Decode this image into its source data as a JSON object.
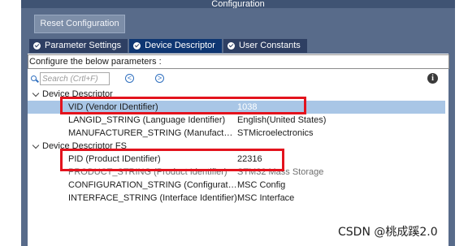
{
  "window": {
    "title": "Configuration"
  },
  "reset_button": {
    "label": "Reset Configuration"
  },
  "tabs": [
    {
      "label": "Parameter Settings",
      "icon": "check-circle-icon"
    },
    {
      "label": "Device Descriptor",
      "icon": "check-circle-icon",
      "active": true
    },
    {
      "label": "User Constants",
      "icon": "check-circle-icon"
    }
  ],
  "configure_text": "Configure the below parameters :",
  "search": {
    "placeholder": "Search (Crtl+F)",
    "prev_icon": "<",
    "next_icon": ">"
  },
  "info_icon": "i",
  "tree": {
    "device_descriptor": {
      "label": "Device Descriptor",
      "params": [
        {
          "name": "VID (Vendor IDentifier)",
          "value": "1038"
        },
        {
          "name": "LANGID_STRING (Language Identifier)",
          "value": "English(United States)"
        },
        {
          "name": "MANUFACTURER_STRING (Manufacturer...",
          "value": "STMicroelectronics"
        }
      ]
    },
    "device_descriptor_fs": {
      "label": "Device Descriptor FS",
      "params": [
        {
          "name": "PID (Product IDentifier)",
          "value": "22316"
        },
        {
          "name": "PRODUCT_STRING (Product Identifier)",
          "value": "STM32 Mass Storage"
        },
        {
          "name": "CONFIGURATION_STRING (Configuration...",
          "value": "MSC Config"
        },
        {
          "name": "INTERFACE_STRING (Interface Identifier)",
          "value": "MSC Interface"
        }
      ]
    }
  },
  "watermark": "CSDN @桃成蹊2.0",
  "colors": {
    "highlight_box": "#e3131d",
    "selected_row": "#a9c6e6",
    "tab_active": "#0e3672",
    "tab_inactive": "#2e3f63"
  }
}
